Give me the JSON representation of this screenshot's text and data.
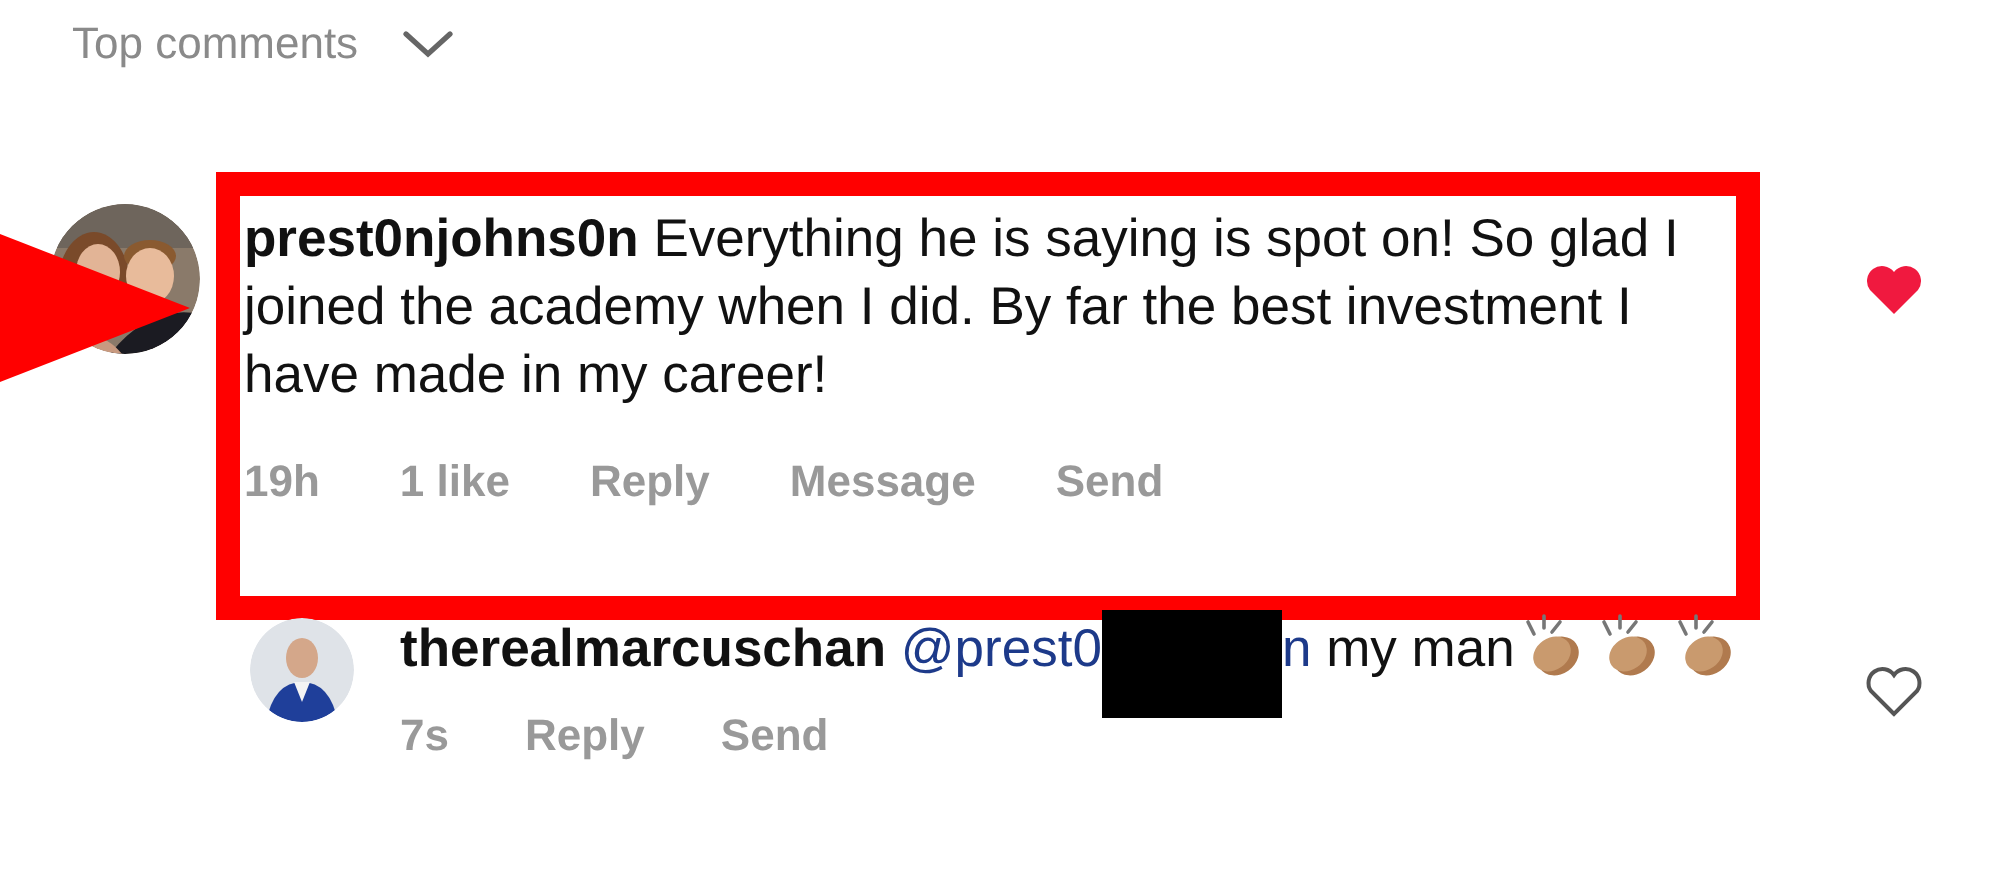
{
  "header": {
    "label": "Top comments",
    "expanded": true
  },
  "comments": [
    {
      "username": "prest0njohns0n",
      "text": "Everything he is saying is spot on! So glad I joined the academy when I did. By far the best investment I have made in my career!",
      "time": "19h",
      "likes": "1 like",
      "actions": [
        "Reply",
        "Message",
        "Send"
      ],
      "liked": true,
      "annotated": true,
      "replies": [
        {
          "username": "therealmarcuschan",
          "mention": "@prest0",
          "mention_tail": "n",
          "redacted": true,
          "text": "my man",
          "emoji": [
            {
              "kind": "clap"
            },
            {
              "kind": "clap"
            },
            {
              "kind": "clap"
            }
          ],
          "time": "7s",
          "actions": [
            "Reply",
            "Send"
          ],
          "liked": false
        }
      ]
    }
  ]
}
